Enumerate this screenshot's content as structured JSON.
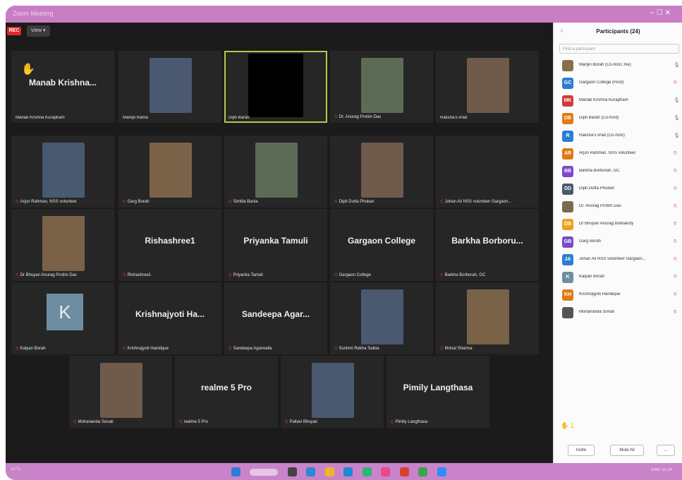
{
  "window": {
    "title": "Zoom Meeting",
    "controls": "⌐ ☐ ✕"
  },
  "toolbar": {
    "rec_label": "REC",
    "view_label": "View ▾"
  },
  "colors": {
    "accent_active": "#b9c54a",
    "titlebar": "#c97ec4",
    "mic_muted": "#e33333"
  },
  "grid": {
    "rows": [
      [
        {
          "big": "Manab  Krishna...",
          "caption": "Manab Krishna Kurapham",
          "kind": "name",
          "hand": true,
          "muted": false
        },
        {
          "caption": "Mampi Rama",
          "kind": "video",
          "muted": false
        },
        {
          "caption": "Dipti Barah",
          "kind": "black",
          "active": true,
          "muted": false
        },
        {
          "caption": "Dr. Anurag Protim Das",
          "kind": "video",
          "muted": true
        },
        {
          "caption": "Raksha's iPad",
          "kind": "video",
          "muted": false
        }
      ],
      [
        {
          "caption": "Arjun Rahman, NSS volunteer",
          "kind": "video",
          "muted": true
        },
        {
          "caption": "Garg Borah",
          "kind": "video",
          "muted": true
        },
        {
          "caption": "Simlita Bania",
          "kind": "video",
          "muted": true
        },
        {
          "caption": "Dipti Dutta Phukan",
          "kind": "video",
          "muted": true
        },
        {
          "caption": "Johan Ali NSS volunteer Gargaon...",
          "kind": "blank",
          "muted": true
        }
      ],
      [
        {
          "caption": "Dr Bhuyan Anurag Protim Das",
          "kind": "video",
          "muted": true
        },
        {
          "big": "Rishashree1",
          "caption": "Rishashree1",
          "kind": "name",
          "muted": true
        },
        {
          "big": "Priyanka Tamuli",
          "caption": "Priyanka Tamuli",
          "kind": "name",
          "muted": true
        },
        {
          "big": "Gargaon College",
          "caption": "Gargaon College",
          "kind": "name",
          "muted": true
        },
        {
          "big": "Barkha Borboru...",
          "caption": "Barkha Borborah, GC",
          "kind": "name",
          "muted": true
        }
      ],
      [
        {
          "caption": "Kalyan Borah",
          "kind": "avatar",
          "avatar_letter": "K",
          "muted": true
        },
        {
          "big": "Krishnajyoti  Ha...",
          "caption": "Krishnajyoti Handique",
          "kind": "name",
          "muted": true
        },
        {
          "big": "Sandeepa  Agar...",
          "caption": "Sandeepa Agarwalla",
          "kind": "name",
          "muted": true
        },
        {
          "caption": "Sushmi Rekha Saikia",
          "kind": "video",
          "muted": true
        },
        {
          "caption": "Mrinal Sharma",
          "kind": "video",
          "muted": true
        }
      ],
      [
        {
          "caption": "Mohananda Sonali",
          "kind": "video",
          "muted": true
        },
        {
          "big": "realme 5 Pro",
          "caption": "realme 5 Pro",
          "kind": "name",
          "muted": true
        },
        {
          "caption": "Pallavi Bhuyan",
          "kind": "video",
          "muted": true
        },
        {
          "big": "Pimily Langthasa",
          "caption": "Pimily Langthasa",
          "kind": "name",
          "muted": true
        }
      ]
    ]
  },
  "participants": {
    "title": "Participants (24)",
    "back": "‹",
    "search_placeholder": "Find a participant",
    "items": [
      {
        "name": "Manjiri Borah (Co-host, me)",
        "initials": "",
        "color": "#8a6e4b",
        "muted": false
      },
      {
        "name": "Gargaon College (Host)",
        "initials": "GC",
        "color": "#2d7dd2",
        "muted": true
      },
      {
        "name": "Manab Krishna Kurapham",
        "initials": "MK",
        "color": "#d33b3b",
        "muted": false
      },
      {
        "name": "Dipti Barah (Co-host)",
        "initials": "DB",
        "color": "#e07b14",
        "muted": false
      },
      {
        "name": "Raksha's iPad (Co-host)",
        "initials": "R",
        "color": "#2d7dd2",
        "muted": false
      },
      {
        "name": "Arjun Rahman, NSS volunteer",
        "initials": "AR",
        "color": "#e07b14",
        "muted": true
      },
      {
        "name": "Barkha Borborah, GC",
        "initials": "BB",
        "color": "#7b4bc9",
        "muted": true
      },
      {
        "name": "Dipti Dutta Phukan",
        "initials": "DD",
        "color": "#4a5a6a",
        "muted": true
      },
      {
        "name": "Dr. Anurag Protim Das",
        "initials": "",
        "color": "#7a6a50",
        "muted": true
      },
      {
        "name": "Dr Bhuyan Anurag Borkakoty",
        "initials": "DB",
        "color": "#f0a020",
        "muted": true
      },
      {
        "name": "Garg Borah",
        "initials": "GB",
        "color": "#7b4bc9",
        "muted": true
      },
      {
        "name": "Johan Ali NSS volunteer Gargaon...",
        "initials": "JA",
        "color": "#2d7dd2",
        "muted": true
      },
      {
        "name": "Kalyan Borah",
        "initials": "K",
        "color": "#6e8ea0",
        "muted": true
      },
      {
        "name": "Krishnajyoti Handique",
        "initials": "KH",
        "color": "#e07b14",
        "muted": true
      },
      {
        "name": "Mohananda Sonali",
        "initials": "",
        "color": "#555555",
        "muted": true
      }
    ],
    "hand_count": "1",
    "invite_label": "Invite",
    "mute_all_label": "Mute All",
    "more_label": "..."
  },
  "taskbar": {
    "weather": "27°C",
    "time": "ENG 11:24"
  }
}
